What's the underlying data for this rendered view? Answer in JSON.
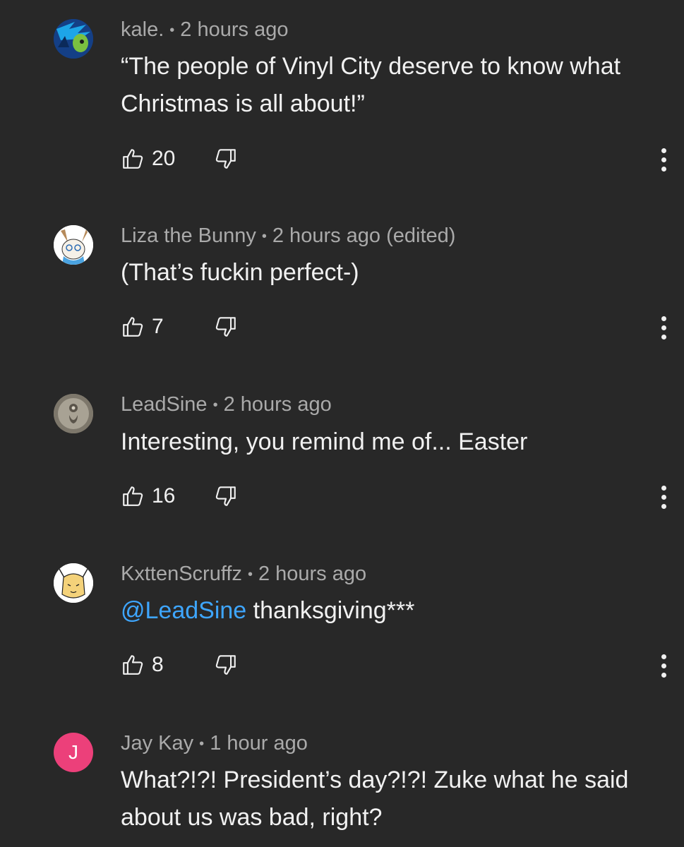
{
  "colors": {
    "background": "#282828",
    "meta": "#aaaaaa",
    "text": "#f1f1f1",
    "mention": "#3ea6ff",
    "avatar_j": "#ec407a"
  },
  "comments": [
    {
      "author": "kale.",
      "time": "2 hours ago",
      "text": "“The people of Vinyl City deserve to know what Christmas is all about!”",
      "likes": "20",
      "avatar": "green-blue-character-avatar"
    },
    {
      "author": "Liza the Bunny",
      "time": "2 hours ago (edited)",
      "text": "(That’s fuckin perfect-)",
      "likes": "7",
      "avatar": "bunny-character-avatar"
    },
    {
      "author": "LeadSine",
      "time": "2 hours ago",
      "text": "Interesting, you remind me of... Easter",
      "likes": "16",
      "avatar": "grey-figure-avatar"
    },
    {
      "author": "KxttenScruffz",
      "time": "2 hours ago",
      "mention": "@LeadSine",
      "text": " thanksgiving***",
      "likes": "8",
      "avatar": "sketch-cat-avatar"
    },
    {
      "author": "Jay Kay",
      "time": "1 hour ago",
      "text": "What?!?! President’s day?!?! Zuke what he said about us was bad, right?",
      "avatar_letter": "J",
      "avatar": "letter-avatar"
    }
  ]
}
